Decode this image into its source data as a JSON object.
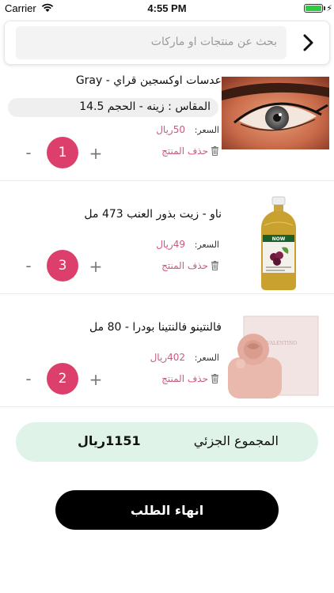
{
  "status_bar": {
    "carrier": "Carrier",
    "time": "4:55 PM"
  },
  "search": {
    "placeholder": "بحث عن منتجات او ماركات",
    "back_icon": "chevron-right-icon"
  },
  "cart": {
    "price_label": "السعر:",
    "delete_label": "حذف المنتج",
    "items": [
      {
        "title": "عدسات اوكسجين قراي - Gray",
        "variant": "المقاس : زينه - الحجم 14.5",
        "price": "50ريال",
        "quantity": "1",
        "image": "eye-lens-image"
      },
      {
        "title": "ناو - زيت بذور العنب 473 مل",
        "price": "49ريال",
        "quantity": "3",
        "image": "grapeseed-oil-image"
      },
      {
        "title": "فالنتينو فالنتينا بودرا - 80 مل",
        "price": "402ريال",
        "quantity": "2",
        "image": "perfume-image"
      }
    ],
    "qty_minus": "-",
    "qty_plus": "+"
  },
  "summary": {
    "subtotal_label": "المجموع الجزئي",
    "subtotal_value": "1151ريال"
  },
  "checkout": {
    "label": "انهاء الطلب"
  },
  "colors": {
    "accent": "#dc3f6c",
    "price": "#c85a83",
    "subtotal_bg": "#dff3e9",
    "checkout_bg": "#000000"
  }
}
